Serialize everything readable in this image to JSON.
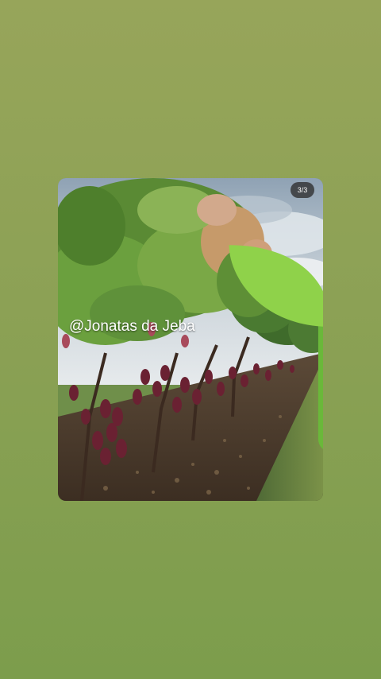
{
  "story": {
    "background_top": "#97a55a",
    "background_bottom": "#7c9d4c",
    "photo": {
      "subject_icon": "cocoa-plantation-photo",
      "counter_text": "3/3",
      "watermark_text": "@Jonatas da Jeba",
      "watermark_icon": "sprout-icon"
    }
  }
}
